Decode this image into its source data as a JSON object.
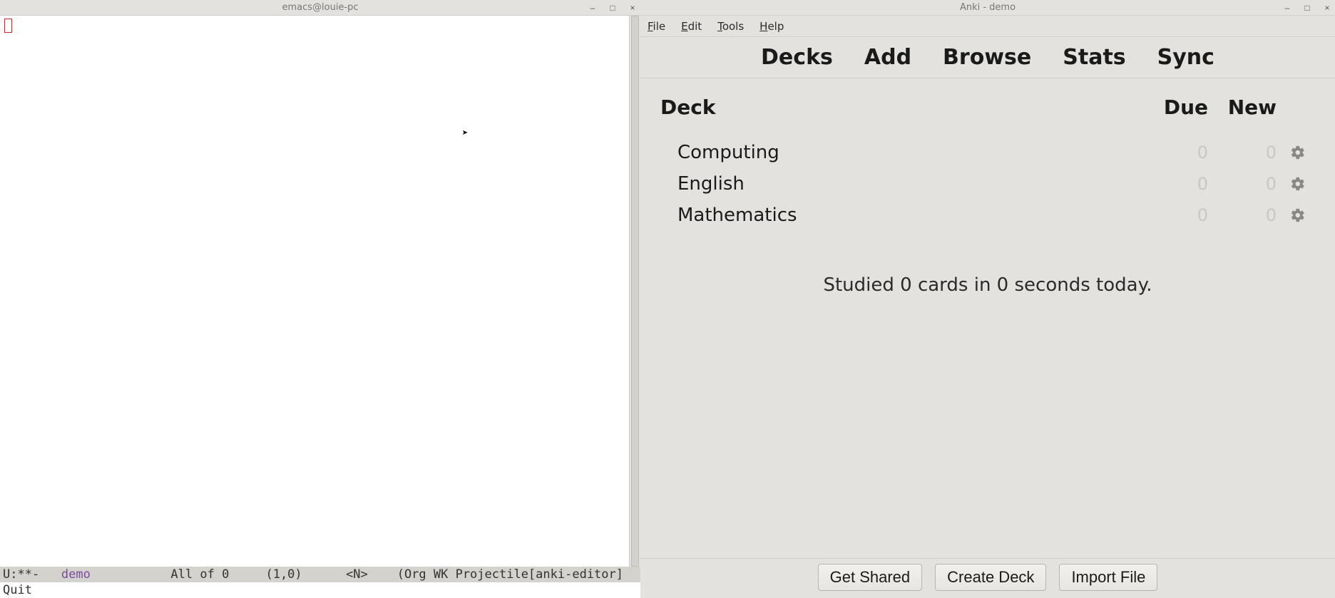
{
  "emacs": {
    "title": "emacs@louie-pc",
    "modeline": {
      "prefix": "U:**-   ",
      "buffer": "demo",
      "mid": "           All of 0     (1,0)      <N>    (Org WK Projectile[anki-editor]"
    },
    "minibuffer": "Quit"
  },
  "anki": {
    "title": "Anki - demo",
    "menubar": {
      "file": "File",
      "edit": "Edit",
      "tools": "Tools",
      "help": "Help"
    },
    "toolbar": {
      "decks": "Decks",
      "add": "Add",
      "browse": "Browse",
      "stats": "Stats",
      "sync": "Sync"
    },
    "columns": {
      "deck": "Deck",
      "due": "Due",
      "new": "New"
    },
    "decks": [
      {
        "name": "Computing",
        "due": "0",
        "new": "0"
      },
      {
        "name": "English",
        "due": "0",
        "new": "0"
      },
      {
        "name": "Mathematics",
        "due": "0",
        "new": "0"
      }
    ],
    "studied_line": "Studied 0 cards in 0 seconds today.",
    "buttons": {
      "get_shared": "Get Shared",
      "create_deck": "Create Deck",
      "import_file": "Import File"
    }
  }
}
